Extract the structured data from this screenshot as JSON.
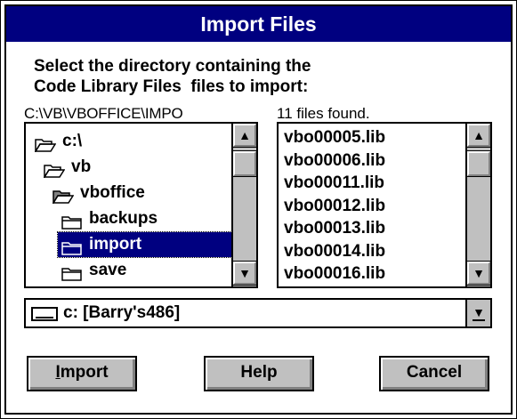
{
  "dialog": {
    "title": "Import Files",
    "prompt_line1": "Select the directory containing the",
    "prompt_line2": "Code Library Files  files to import:",
    "current_path": "C:\\VB\\VBOFFICE\\IMPO",
    "files_found": "11 files found."
  },
  "directories": [
    {
      "label": "c:\\",
      "icon": "open-folder-icon",
      "selected": false
    },
    {
      "label": "vb",
      "icon": "open-folder-icon",
      "selected": false
    },
    {
      "label": "vboffice",
      "icon": "open-folder-shaded-icon",
      "selected": false
    },
    {
      "label": "backups",
      "icon": "closed-folder-icon",
      "selected": false
    },
    {
      "label": "import",
      "icon": "closed-folder-icon",
      "selected": true
    },
    {
      "label": "save",
      "icon": "closed-folder-icon",
      "selected": false
    }
  ],
  "files": [
    "vbo00005.lib",
    "vbo00006.lib",
    "vbo00011.lib",
    "vbo00012.lib",
    "vbo00013.lib",
    "vbo00014.lib",
    "vbo00016.lib"
  ],
  "drive": {
    "value": "c: [Barry's486]",
    "icon": "drive-icon"
  },
  "buttons": {
    "import_prefix": "",
    "import_hotkey": "I",
    "import_rest": "mport",
    "help": "Help",
    "cancel": "Cancel"
  },
  "scroll_glyphs": {
    "up": "▲",
    "down": "▼",
    "combo": "▼"
  },
  "colors": {
    "titlebar": "#000080",
    "selection": "#000080",
    "face": "#c0c0c0"
  }
}
